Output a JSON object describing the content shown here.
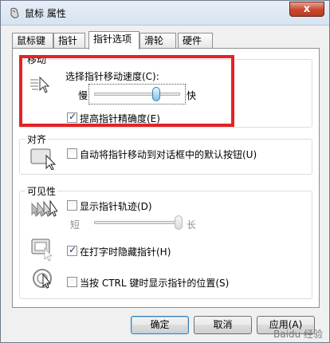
{
  "window": {
    "title": "鼠标 属性",
    "close_glyph": "x"
  },
  "tabs": [
    {
      "label": "鼠标键",
      "active": false
    },
    {
      "label": "指针",
      "active": false
    },
    {
      "label": "指针选项",
      "active": true
    },
    {
      "label": "滑轮",
      "active": false
    },
    {
      "label": "硬件",
      "active": false
    }
  ],
  "motion": {
    "group_title": "移动",
    "speed_label": "选择指针移动速度(C):",
    "slow": "慢",
    "fast": "快",
    "speed_fraction": 0.72,
    "precision_label": "提高指针精确度(E)",
    "precision_checked": true
  },
  "snap": {
    "group_title": "对齐",
    "snap_label": "自动将指针移动到对话框中的默认按钮(U)",
    "snap_checked": false
  },
  "visibility": {
    "group_title": "可见性",
    "trails_label": "显示指针轨迹(D)",
    "trails_checked": false,
    "short": "短",
    "long": "长",
    "trails_fraction": 1.0,
    "hide_label": "在打字时隐藏指针(H)",
    "hide_checked": true,
    "ctrl_label": "当按 CTRL 键时显示指针的位置(S)",
    "ctrl_checked": false
  },
  "buttons": {
    "ok": "确定",
    "cancel": "取消",
    "apply": "应用(A)"
  },
  "watermark": "Baidu 经验",
  "colors": {
    "highlight_box": "#e52224",
    "thumb": "#7ec3ed"
  }
}
